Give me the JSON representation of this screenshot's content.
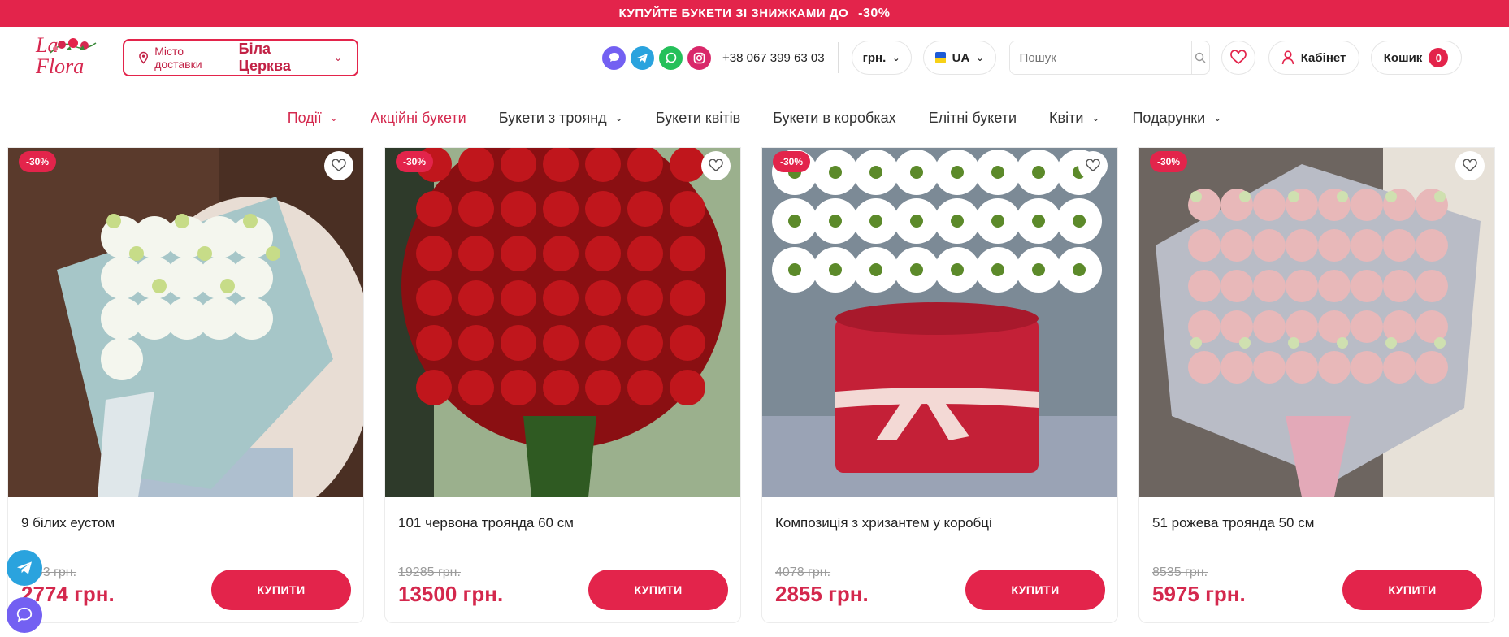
{
  "promo": {
    "text": "КУПУЙТЕ БУКЕТИ ЗІ ЗНИЖКАМИ ДО",
    "percent": "-30%"
  },
  "header": {
    "logo_text": "La Flora",
    "city_label": "Місто доставки",
    "city_value": "Біла Церква",
    "phone": "+38 067 399 63 03",
    "currency": "грн.",
    "language": "UA",
    "search_placeholder": "Пошук",
    "cabinet_label": "Кабінет",
    "cart_label": "Кошик",
    "cart_count": "0"
  },
  "nav": [
    {
      "label": "Події",
      "dropdown": true,
      "accent": true
    },
    {
      "label": "Акційні букети",
      "dropdown": false,
      "accent": true
    },
    {
      "label": "Букети з троянд",
      "dropdown": true,
      "accent": false
    },
    {
      "label": "Букети квітів",
      "dropdown": false,
      "accent": false
    },
    {
      "label": "Букети в коробках",
      "dropdown": false,
      "accent": false
    },
    {
      "label": "Елітні букети",
      "dropdown": false,
      "accent": false
    },
    {
      "label": "Квіти",
      "dropdown": true,
      "accent": false
    },
    {
      "label": "Подарунки",
      "dropdown": true,
      "accent": false
    }
  ],
  "products": [
    {
      "badge": "-30%",
      "title": "9 білих еустом",
      "old_price": "3963 грн.",
      "price": "2774 грн.",
      "buy": "КУПИТИ"
    },
    {
      "badge": "-30%",
      "title": "101 червона троянда 60 см",
      "old_price": "19285 грн.",
      "price": "13500 грн.",
      "buy": "КУПИТИ"
    },
    {
      "badge": "-30%",
      "title": "Композиція з хризантем у коробці",
      "old_price": "4078 грн.",
      "price": "2855 грн.",
      "buy": "КУПИТИ"
    },
    {
      "badge": "-30%",
      "title": "51 рожева троянда 50 см",
      "old_price": "8535 грн.",
      "price": "5975 грн.",
      "buy": "КУПИТИ"
    }
  ],
  "colors": {
    "accent": "#e3244b",
    "accent_text": "#d4284d"
  }
}
